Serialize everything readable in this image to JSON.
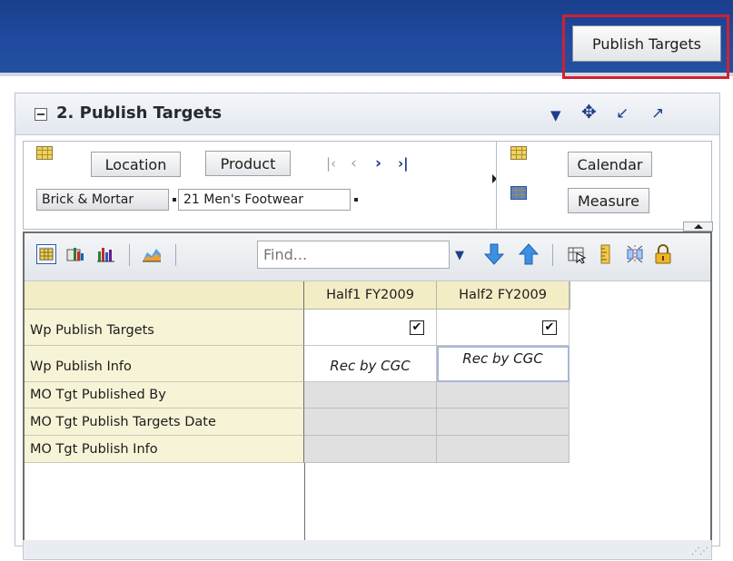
{
  "header": {
    "publish_button": "Publish Targets"
  },
  "panel": {
    "title": "2. Publish Targets",
    "header_icons": [
      "menu-dropdown-icon",
      "move-icon",
      "minimize-icon",
      "maximize-icon"
    ]
  },
  "pov": {
    "location_label": "Location",
    "product_label": "Product",
    "location_value": "Brick & Mortar",
    "product_value": "21 Men's Footwear",
    "calendar_label": "Calendar",
    "measure_label": "Measure"
  },
  "toolbar": {
    "find_placeholder": "Find..."
  },
  "grid": {
    "columns": [
      "Half1 FY2009",
      "Half2 FY2009"
    ],
    "rows": [
      {
        "label": "Wp Publish Targets",
        "values": [
          "✔",
          "✔"
        ]
      },
      {
        "label": "Wp Publish Info",
        "values": [
          "Rec by CGC",
          "Rec by CGC"
        ]
      },
      {
        "label": "MO Tgt Published By",
        "values": [
          "",
          ""
        ]
      },
      {
        "label": "MO Tgt Publish Targets Date",
        "values": [
          "",
          ""
        ]
      },
      {
        "label": "MO Tgt Publish Info",
        "values": [
          "",
          ""
        ]
      }
    ]
  },
  "colors": {
    "topbar": "#1f4aa0",
    "highlight": "#d2202f",
    "row_header_bg": "#f7f3d6",
    "read_only_cell": "#e0e0e0"
  }
}
